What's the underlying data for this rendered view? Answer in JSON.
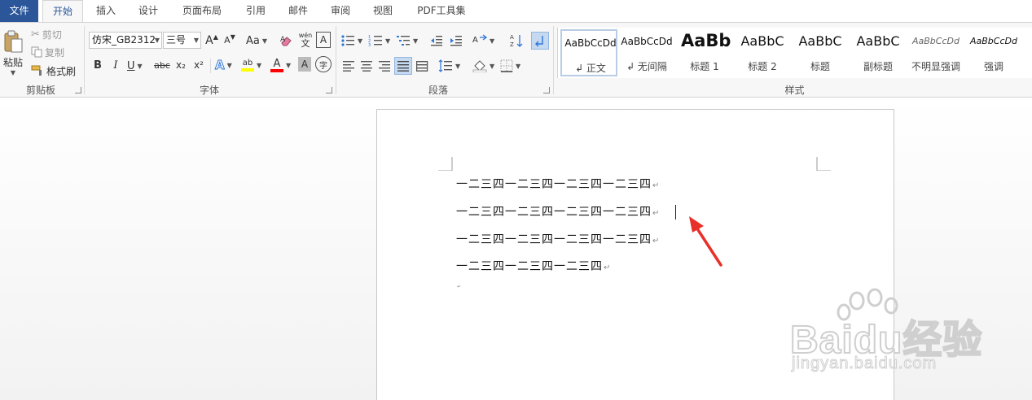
{
  "tabs": [
    {
      "label": "文件"
    },
    {
      "label": "开始"
    },
    {
      "label": "插入"
    },
    {
      "label": "设计"
    },
    {
      "label": "页面布局"
    },
    {
      "label": "引用"
    },
    {
      "label": "邮件"
    },
    {
      "label": "审阅"
    },
    {
      "label": "视图"
    },
    {
      "label": "PDF工具集"
    }
  ],
  "clipboard": {
    "paste": "粘贴",
    "cut": "剪切",
    "copy": "复制",
    "format_painter": "格式刷",
    "group_label": "剪贴板"
  },
  "font": {
    "name": "仿宋_GB2312",
    "size": "三号",
    "group_label": "字体",
    "change_case": "Aa",
    "bold": "B",
    "italic": "I",
    "underline": "U",
    "strikethrough": "abc",
    "subscript": "x₂",
    "superscript": "x²",
    "phonetic": "wén",
    "phonetic_char": "文",
    "border_char": "A",
    "grow": "A",
    "shrink": "A",
    "text_effects": "A",
    "highlight": "ab",
    "font_color": "A",
    "char_shade": "A",
    "enclose": "字",
    "highlight_color": "#ffff00",
    "font_color_value": "#ff0000"
  },
  "paragraph": {
    "group_label": "段落"
  },
  "styles": {
    "group_label": "样式",
    "items": [
      {
        "preview": "AaBbCcDd",
        "name": "↲ 正文"
      },
      {
        "preview": "AaBbCcDd",
        "name": "↲ 无间隔"
      },
      {
        "preview": "AaBb",
        "name": "标题 1"
      },
      {
        "preview": "AaBbC",
        "name": "标题 2"
      },
      {
        "preview": "AaBbC",
        "name": "标题"
      },
      {
        "preview": "AaBbC",
        "name": "副标题"
      },
      {
        "preview": "AaBbCcDd",
        "name": "不明显强调"
      },
      {
        "preview": "AaBbCcDd",
        "name": "强调"
      }
    ]
  },
  "document": {
    "lines": [
      {
        "text": "一二三四一二三四一二三四一二三四",
        "mark": "↵"
      },
      {
        "text": "一二三四一二三四一二三四一二三四",
        "mark": "↵"
      },
      {
        "text": "一二三四一二三四一二三四一二三四",
        "mark": "↵"
      },
      {
        "text": "一二三四一二三四一二三四",
        "mark": "↵"
      },
      {
        "text": "",
        "mark": "↵"
      }
    ]
  },
  "annotation": {
    "color": "#e8302a"
  },
  "watermark": {
    "text": "Baidu经验",
    "url": "jingyan.baidu.com"
  },
  "colors": {
    "accent": "#2b579a"
  }
}
